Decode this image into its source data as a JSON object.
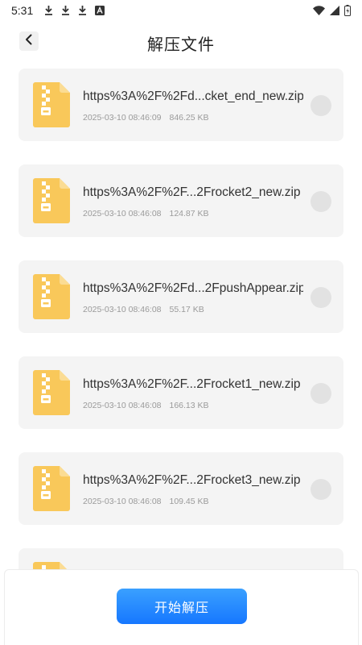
{
  "status_bar": {
    "time": "5:31",
    "left_icons": [
      "download-icon",
      "download-icon",
      "download-icon",
      "a-icon"
    ],
    "right_icons": [
      "wifi-icon",
      "signal-icon",
      "battery-icon"
    ]
  },
  "header": {
    "title": "解压文件",
    "back_icon": "chevron-left-icon"
  },
  "files": [
    {
      "name": "https%3A%2F%2Fd...cket_end_new.zip",
      "date": "2025-03-10 08:46:09",
      "size": "846.25 KB"
    },
    {
      "name": "https%3A%2F%2F...2Frocket2_new.zip",
      "date": "2025-03-10 08:46:08",
      "size": "124.87 KB"
    },
    {
      "name": "https%3A%2F%2Fd...2FpushAppear.zip",
      "date": "2025-03-10 08:46:08",
      "size": "55.17 KB"
    },
    {
      "name": "https%3A%2F%2F...2Frocket1_new.zip",
      "date": "2025-03-10 08:46:08",
      "size": "166.13 KB"
    },
    {
      "name": "https%3A%2F%2F...2Frocket3_new.zip",
      "date": "2025-03-10 08:46:08",
      "size": "109.45 KB"
    },
    {
      "name": "",
      "date": "",
      "size": ""
    }
  ],
  "colors": {
    "accent": "#1677ff",
    "zip_icon": "#f9c85a",
    "card_bg": "#f4f4f4"
  },
  "bottom": {
    "start_label": "开始解压"
  }
}
